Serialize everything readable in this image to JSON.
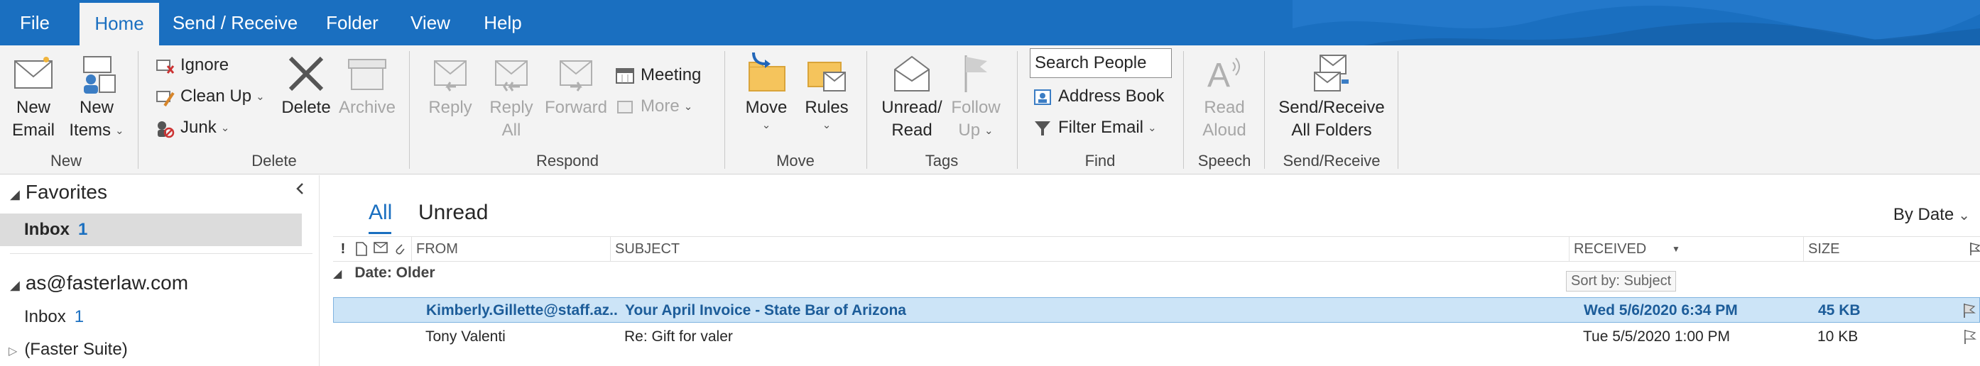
{
  "menu": {
    "tabs": [
      "File",
      "Home",
      "Send / Receive",
      "Folder",
      "View",
      "Help"
    ],
    "active": "Home"
  },
  "ribbon": {
    "groups": {
      "new": "New",
      "delete": "Delete",
      "respond": "Respond",
      "move": "Move",
      "tags": "Tags",
      "find": "Find",
      "speech": "Speech",
      "sendreceive": "Send/Receive"
    },
    "new_email": [
      "New",
      "Email"
    ],
    "new_items": [
      "New",
      "Items"
    ],
    "ignore": "Ignore",
    "clean_up": "Clean Up",
    "junk": "Junk",
    "delete": "Delete",
    "archive": "Archive",
    "reply": "Reply",
    "reply_all": [
      "Reply",
      "All"
    ],
    "forward": "Forward",
    "meeting": "Meeting",
    "more": "More",
    "move": "Move",
    "rules": "Rules",
    "unread_read": [
      "Unread/",
      "Read"
    ],
    "follow_up": [
      "Follow",
      "Up"
    ],
    "search_people": "Search People",
    "address_book": "Address Book",
    "filter_email": "Filter Email",
    "read_aloud": [
      "Read",
      "Aloud"
    ],
    "send_receive_all": [
      "Send/Receive",
      "All Folders"
    ]
  },
  "nav": {
    "favorites": "Favorites",
    "fav_inbox": "Inbox",
    "fav_inbox_count": "1",
    "account": "as@fasterlaw.com",
    "inbox": "Inbox",
    "inbox_count": "1",
    "faster_suite": "(Faster Suite)"
  },
  "list": {
    "tab_all": "All",
    "tab_unread": "Unread",
    "sort": "By Date",
    "columns": {
      "from": "FROM",
      "subject": "SUBJECT",
      "received": "RECEIVED",
      "size": "SIZE"
    },
    "group": "Date: Older",
    "tooltip": "Sort by: Subject",
    "rows": [
      {
        "from": "Kimberly.Gillette@staff.az...",
        "subject": "Your April Invoice - State Bar of Arizona",
        "received": "Wed 5/6/2020 6:34 PM",
        "size": "45 KB"
      },
      {
        "from": "Tony Valenti",
        "subject": "Re: Gift for valer",
        "received": "Tue 5/5/2020 1:00 PM",
        "size": "10 KB"
      }
    ]
  },
  "colors": {
    "accent": "#1a6fc0",
    "selected_row": "#cce4f7",
    "ribbon_bg": "#f3f3f3"
  }
}
